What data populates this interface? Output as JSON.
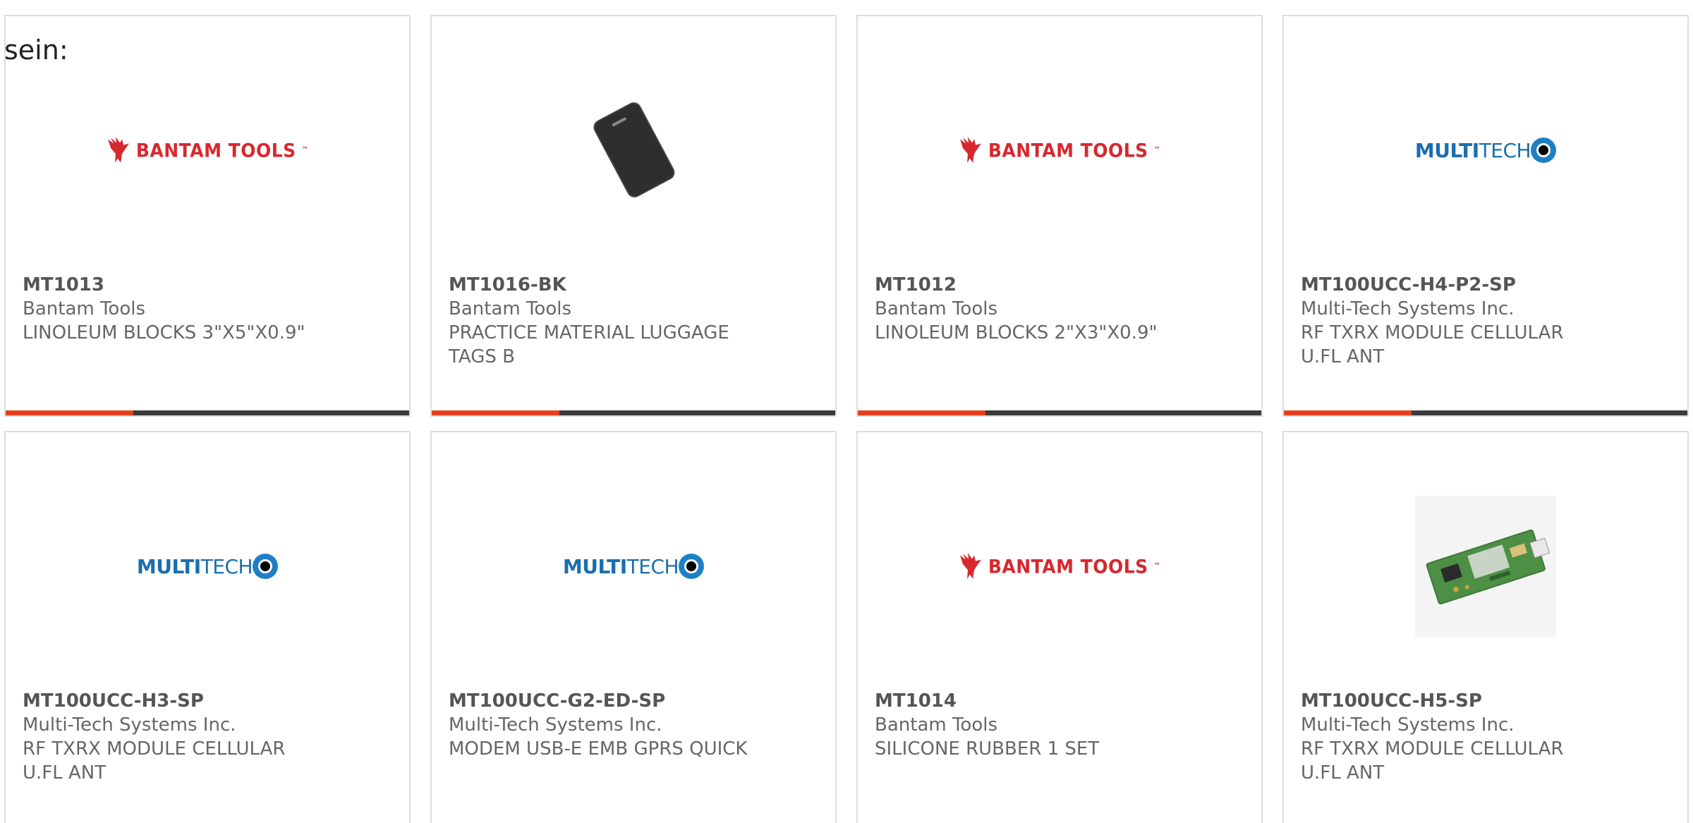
{
  "intro_text": "sein:",
  "products": [
    {
      "part": "MT1013",
      "manufacturer": "Bantam Tools",
      "description": "LINOLEUM BLOCKS 3\"X5\"X0.9\"",
      "image": "bantam-tools-logo"
    },
    {
      "part": "MT1016-BK",
      "manufacturer": "Bantam Tools",
      "description": "PRACTICE MATERIAL LUGGAGE TAGS B",
      "image": "luggage-tag-photo"
    },
    {
      "part": "MT1012",
      "manufacturer": "Bantam Tools",
      "description": "LINOLEUM BLOCKS 2\"X3\"X0.9\"",
      "image": "bantam-tools-logo"
    },
    {
      "part": "MT100UCC-H4-P2-SP",
      "manufacturer": "Multi-Tech Systems Inc.",
      "description": "RF TXRX MODULE CELLULAR U.FL ANT",
      "image": "multitech-logo"
    },
    {
      "part": "MT100UCC-H3-SP",
      "manufacturer": "Multi-Tech Systems Inc.",
      "description": "RF TXRX MODULE CELLULAR U.FL ANT",
      "image": "multitech-logo"
    },
    {
      "part": "MT100UCC-G2-ED-SP",
      "manufacturer": "Multi-Tech Systems Inc.",
      "description": "MODEM USB-E EMB GPRS QUICK",
      "image": "multitech-logo"
    },
    {
      "part": "MT1014",
      "manufacturer": "Bantam Tools",
      "description": "SILICONE RUBBER 1 SET",
      "image": "bantam-tools-logo"
    },
    {
      "part": "MT100UCC-H5-SP",
      "manufacturer": "Multi-Tech Systems Inc.",
      "description": "RF TXRX MODULE CELLULAR U.FL ANT",
      "image": "circuit-board-photo"
    }
  ],
  "logos": {
    "bantam": "BANTAM TOOLS",
    "bantam_tm": "™",
    "multitech_bold": "MULTI",
    "multitech_light": "TECH"
  },
  "colors": {
    "accent": "#e8401c",
    "bar": "#3a3a3a",
    "bantam_red": "#d7282f",
    "multitech_blue": "#1a6fae"
  }
}
